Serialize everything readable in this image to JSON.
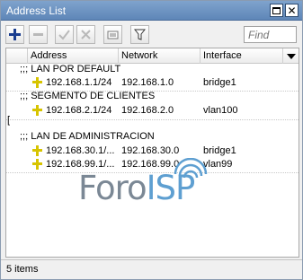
{
  "window": {
    "title": "Address List"
  },
  "toolbar": {
    "find_placeholder": "Find",
    "buttons": [
      "plus-icon",
      "minus-icon",
      "check-icon",
      "cross-icon",
      "note-icon",
      "filter-icon"
    ]
  },
  "columns": {
    "address": "Address",
    "network": "Network",
    "interface": "Interface"
  },
  "rows": [
    {
      "type": "comment",
      "text": ";;; LAN POR DEFAULT"
    },
    {
      "type": "item",
      "address": "192.168.1.1/24",
      "network": "192.168.1.0",
      "interface": "bridge1"
    },
    {
      "type": "comment",
      "text": ";;; SEGMENTO DE CLIENTES"
    },
    {
      "type": "item",
      "address": "192.168.2.1/24",
      "network": "192.168.2.0",
      "interface": "vlan100"
    },
    {
      "type": "comment",
      "text": ";;; LAN DE ADMINISTRACION"
    },
    {
      "type": "item",
      "address": "192.168.30.1/...",
      "network": "192.168.30.0",
      "interface": "bridge1"
    },
    {
      "type": "item",
      "address": "192.168.99.1/...",
      "network": "192.168.99.0",
      "interface": "vlan99"
    }
  ],
  "side_marker": "[",
  "watermark": {
    "text_a": "Foro",
    "text_b": "ISP"
  },
  "status": {
    "text": "5 items"
  },
  "colors": {
    "titlebar": "#5e86b8",
    "plus": "#1a3d8f",
    "address_icon": "#d7c400",
    "logo_grey": "#7b8895",
    "logo_blue": "#5e9fd1"
  }
}
